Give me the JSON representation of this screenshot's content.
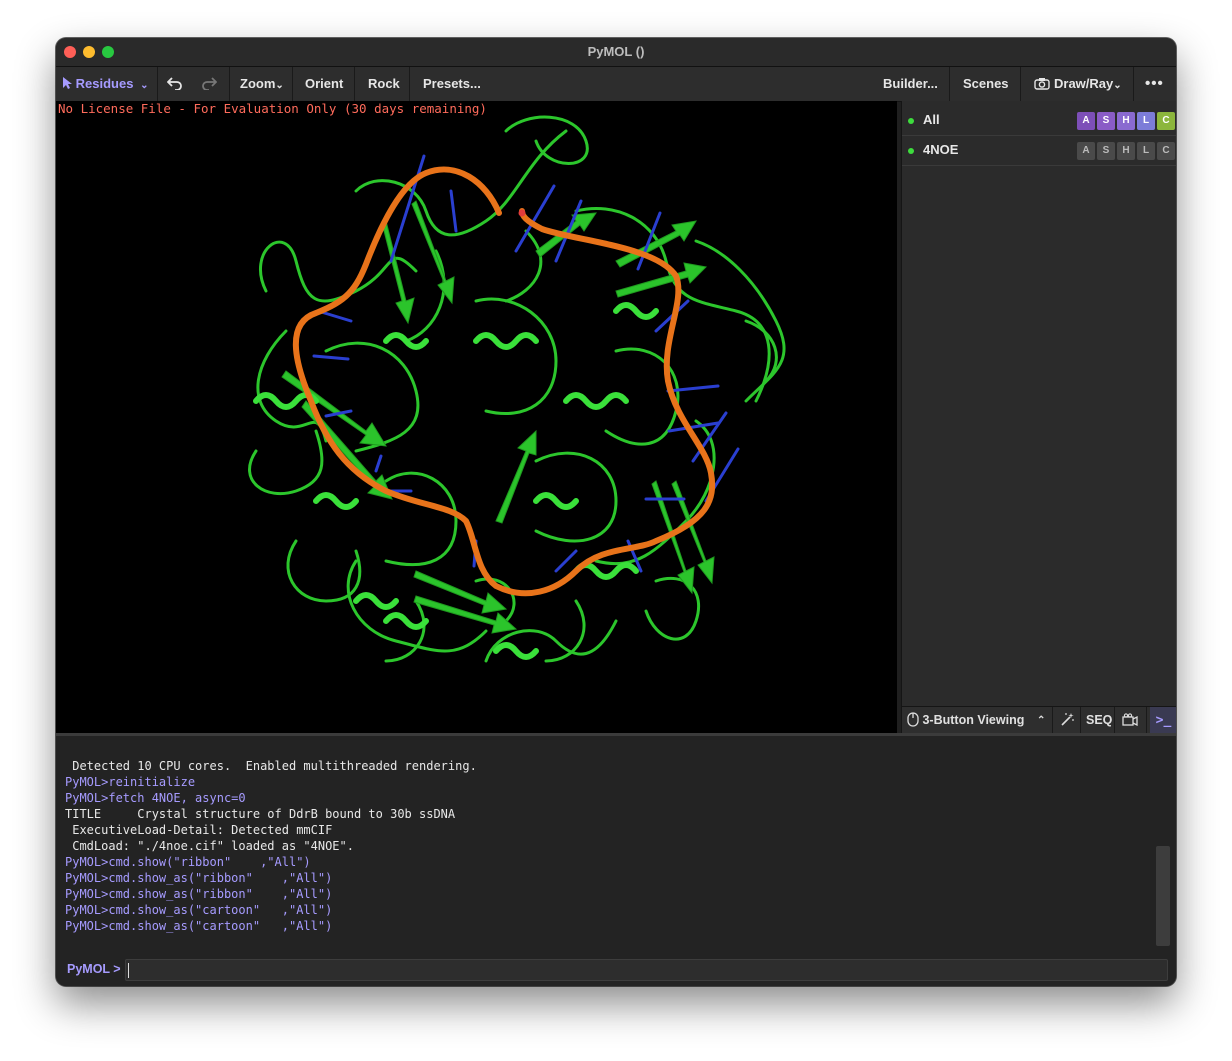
{
  "window": {
    "title": "PyMOL ()"
  },
  "toolbar": {
    "selection_mode": "Residues",
    "zoom": "Zoom",
    "orient": "Orient",
    "rock": "Rock",
    "presets": "Presets...",
    "builder": "Builder...",
    "scenes": "Scenes",
    "draw_ray": "Draw/Ray"
  },
  "viewport": {
    "license_notice": "No License File - For Evaluation Only (30 days remaining)",
    "colors": {
      "protein": "#2fd12f",
      "dna_backbone": "#e8731a",
      "bases": "#2a3fd0"
    }
  },
  "objects": [
    {
      "name": "All",
      "buttons": [
        "A",
        "S",
        "H",
        "L",
        "C"
      ],
      "enabled": true
    },
    {
      "name": "4NOE",
      "buttons": [
        "A",
        "S",
        "H",
        "L",
        "C"
      ],
      "enabled": true
    }
  ],
  "mode_bar": {
    "mouse_mode": "3-Button Viewing",
    "seq": "SEQ"
  },
  "console": {
    "lines": [
      {
        "kind": "out",
        "text": " Detected 10 CPU cores.  Enabled multithreaded rendering."
      },
      {
        "kind": "cmd",
        "text": "PyMOL>reinitialize"
      },
      {
        "kind": "cmd",
        "text": "PyMOL>fetch 4NOE, async=0"
      },
      {
        "kind": "out",
        "text": "TITLE     Crystal structure of DdrB bound to 30b ssDNA"
      },
      {
        "kind": "out",
        "text": " ExecutiveLoad-Detail: Detected mmCIF"
      },
      {
        "kind": "out",
        "text": " CmdLoad: \"./4noe.cif\" loaded as \"4NOE\"."
      },
      {
        "kind": "cmd",
        "text": "PyMOL>cmd.show(\"ribbon\"    ,\"All\")"
      },
      {
        "kind": "cmd",
        "text": "PyMOL>cmd.show_as(\"ribbon\"    ,\"All\")"
      },
      {
        "kind": "cmd",
        "text": "PyMOL>cmd.show_as(\"ribbon\"    ,\"All\")"
      },
      {
        "kind": "cmd",
        "text": "PyMOL>cmd.show_as(\"cartoon\"   ,\"All\")"
      },
      {
        "kind": "cmd",
        "text": "PyMOL>cmd.show_as(\"cartoon\"   ,\"All\")"
      }
    ],
    "prompt": "PyMOL >",
    "input_value": ""
  }
}
